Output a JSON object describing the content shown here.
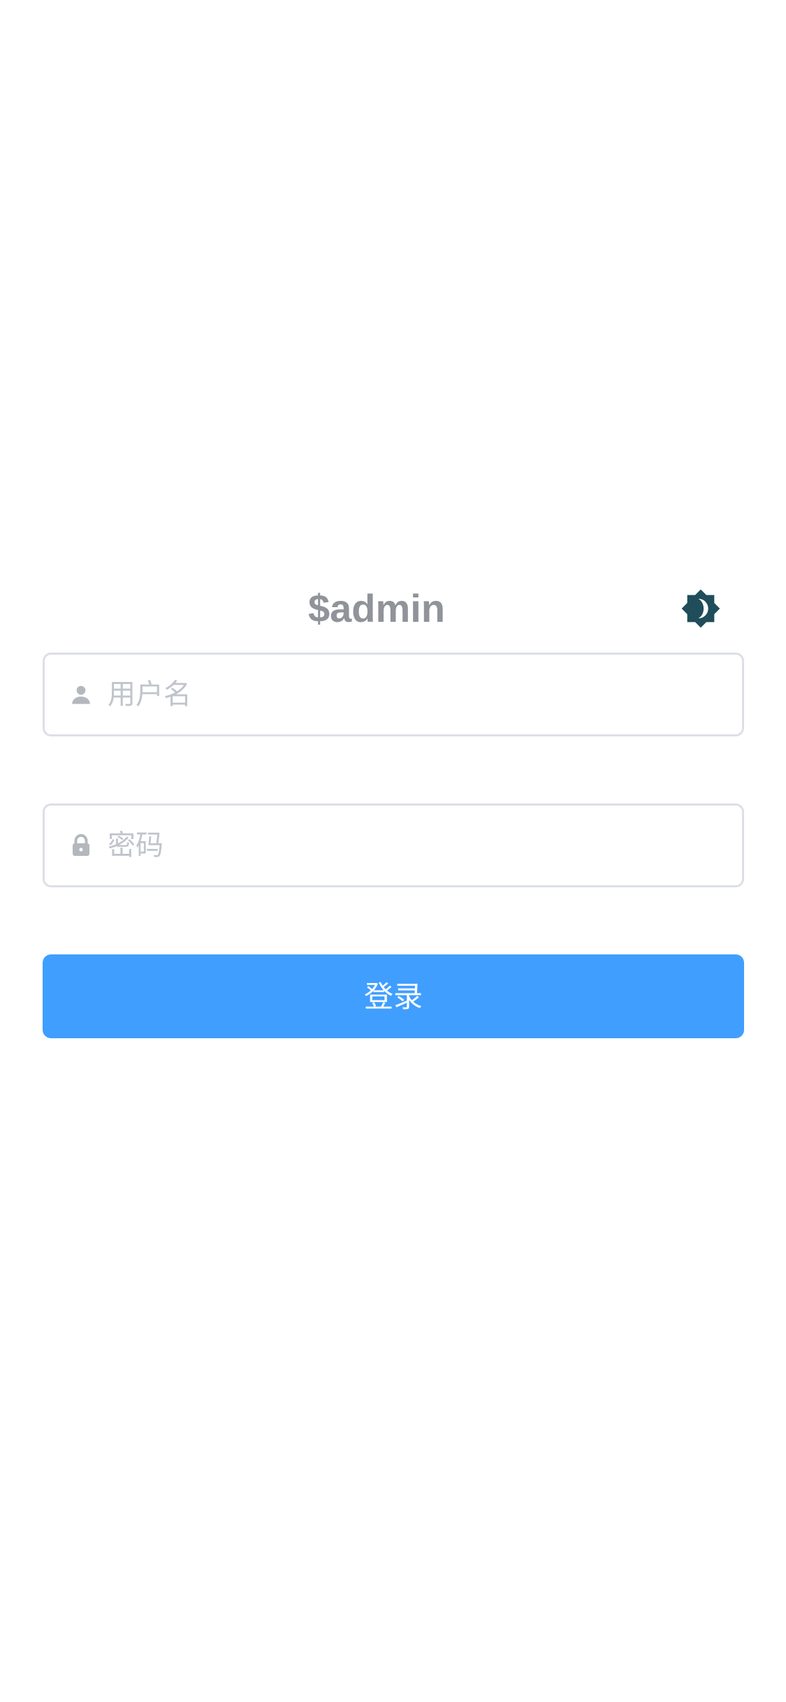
{
  "app": {
    "title": "$admin"
  },
  "theme_toggle": {
    "icon": "brightness-icon",
    "color": "#1f4d5a"
  },
  "form": {
    "username": {
      "icon": "user-icon",
      "placeholder": "用户名",
      "value": ""
    },
    "password": {
      "icon": "lock-icon",
      "placeholder": "密码",
      "value": ""
    },
    "login_label": "登录"
  },
  "colors": {
    "primary": "#409eff",
    "title": "#909399",
    "placeholder": "#c0c4cc",
    "border": "#dcdfe6"
  }
}
